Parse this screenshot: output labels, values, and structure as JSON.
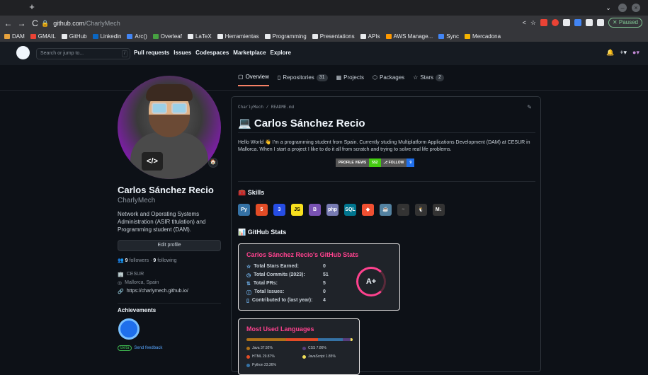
{
  "browser": {
    "url_host": "github.com",
    "url_path": "/CharlyMech",
    "paused_label": "Paused",
    "bookmarks": [
      {
        "label": "DAM",
        "color": "#e8a33d"
      },
      {
        "label": "GMAIL",
        "color": "#ea4335"
      },
      {
        "label": "GitHub",
        "color": "#e8eaed"
      },
      {
        "label": "Linkedin",
        "color": "#0a66c2"
      },
      {
        "label": "Arc()",
        "color": "#4285f4"
      },
      {
        "label": "Overleaf",
        "color": "#47a141"
      },
      {
        "label": "LaTeX",
        "color": "#e8eaed"
      },
      {
        "label": "Herramientas",
        "color": "#e8eaed"
      },
      {
        "label": "Programming",
        "color": "#e8eaed"
      },
      {
        "label": "Presentations",
        "color": "#e8eaed"
      },
      {
        "label": "APIs",
        "color": "#e8eaed"
      },
      {
        "label": "AWS Manage...",
        "color": "#ff9900"
      },
      {
        "label": "Sync",
        "color": "#4285f4"
      },
      {
        "label": "Mercadona",
        "color": "#f5b400"
      }
    ]
  },
  "github": {
    "search_placeholder": "Search or jump to...",
    "search_key": "/",
    "nav": [
      "Pull requests",
      "Issues",
      "Codespaces",
      "Marketplace",
      "Explore"
    ],
    "tabs": [
      {
        "label": "Overview",
        "count": ""
      },
      {
        "label": "Repositories",
        "count": "31"
      },
      {
        "label": "Projects",
        "count": ""
      },
      {
        "label": "Packages",
        "count": ""
      },
      {
        "label": "Stars",
        "count": "2"
      }
    ]
  },
  "profile": {
    "name": "Carlos Sánchez Recio",
    "login": "CharlyMech",
    "bio": "Network and Operating Systems Administration (ASIR titulation) and Programming student (DAM).",
    "edit_label": "Edit profile",
    "followers": "9",
    "followers_label": "followers",
    "following": "9",
    "following_label": "following",
    "company": "CESUR",
    "location": "Mallorca, Spain",
    "website": "https://charlymech.github.io/",
    "achievements_title": "Achievements",
    "beta_label": "Beta",
    "feedback_label": "Send feedback"
  },
  "readme": {
    "path": "CharlyMech / README.md",
    "title": "Carlos Sánchez Recio",
    "intro": "Hello World 👋 I'm a programming student from Spain. Currently studing Multiplatform Applications Development (DAM) at CESUR in Mallorca. When I start a project I like to do it all from scratch and trying to solve real life problems.",
    "views_label": "PROFILE VIEWS",
    "views_value": "552",
    "follow_label": "FOLLOW",
    "follow_value": "9",
    "skills_title": "Skills",
    "stats_title": "GitHub Stats"
  },
  "stats_card": {
    "title": "Carlos Sánchez Recio's GitHub Stats",
    "rows": [
      {
        "label": "Total Stars Earned:",
        "value": "0"
      },
      {
        "label": "Total Commits (2023):",
        "value": "51"
      },
      {
        "label": "Total PRs:",
        "value": "5"
      },
      {
        "label": "Total Issues:",
        "value": "0"
      },
      {
        "label": "Contributed to (last year):",
        "value": "4"
      }
    ],
    "grade": "A+"
  },
  "langs_card": {
    "title": "Most Used Languages",
    "items": [
      {
        "label": "Java 37.92%",
        "color": "#b07219",
        "pct": 37.92
      },
      {
        "label": "CSS 7.86%",
        "color": "#563d7c",
        "pct": 7.86
      },
      {
        "label": "HTML 29.87%",
        "color": "#e34c26",
        "pct": 29.87
      },
      {
        "label": "JavaScript 1.85%",
        "color": "#f1e05a",
        "pct": 1.85
      },
      {
        "label": "Python 23.36%",
        "color": "#3572a5",
        "pct": 23.36
      }
    ]
  }
}
